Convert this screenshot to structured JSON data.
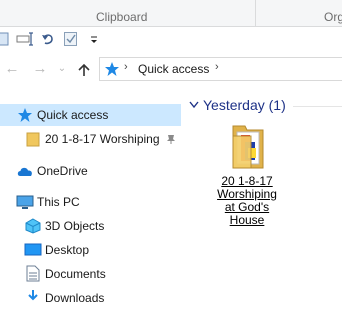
{
  "ribbon": {
    "group_clipboard": "Clipboard",
    "group_organize_partial": "Org"
  },
  "address_bar": {
    "crumb": "Quick access",
    "location_icon": "star-icon"
  },
  "nav_pane": {
    "items": [
      {
        "label": "Quick access",
        "icon": "star-icon",
        "selected": true
      },
      {
        "label": "20 1-8-17 Worshiping",
        "icon": "folder-icon",
        "pinned": true
      },
      {
        "label": "OneDrive",
        "icon": "cloud-icon"
      },
      {
        "label": "This PC",
        "icon": "computer-icon"
      },
      {
        "label": "3D Objects",
        "icon": "3d-objects-icon"
      },
      {
        "label": "Desktop",
        "icon": "desktop-icon"
      },
      {
        "label": "Documents",
        "icon": "documents-icon"
      },
      {
        "label": "Downloads",
        "icon": "downloads-icon"
      }
    ]
  },
  "content": {
    "group_header": "Yesterday (1)",
    "file": {
      "name": "20 1-8-17 Worshiping at God's House",
      "name_lines": [
        "20 1-8-17",
        "Worshiping",
        "at God's",
        "House"
      ],
      "icon": "folder-icon"
    }
  },
  "colors": {
    "selection": "#cce8ff",
    "group_header": "#1e3287",
    "folder": "#f0c75e"
  }
}
